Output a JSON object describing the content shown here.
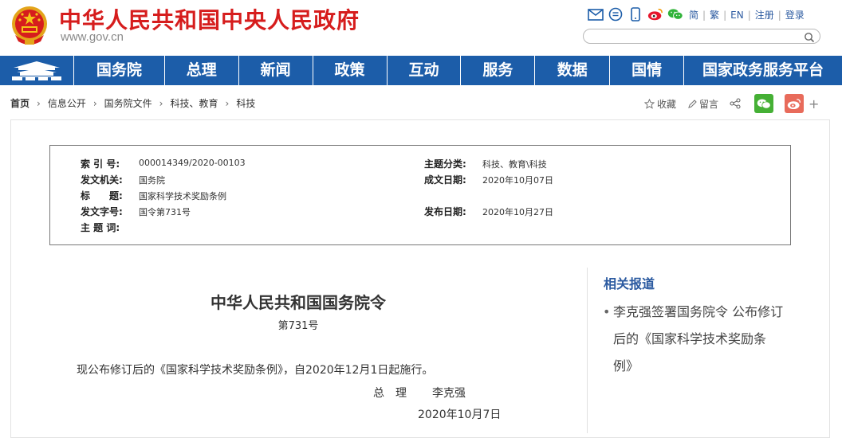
{
  "header": {
    "site_title": "中华人民共和国中央人民政府",
    "site_url": "www.gov.cn",
    "icons": [
      "mail-icon",
      "message-icon",
      "mobile-icon",
      "weibo-icon",
      "wechat-icon"
    ],
    "links": [
      "简",
      "繁",
      "EN",
      "注册",
      "登录"
    ],
    "search_placeholder": "",
    "brand_color": "#d61d1d"
  },
  "nav": {
    "bg_color": "#1c5da9",
    "items": [
      "国务院",
      "总理",
      "新闻",
      "政策",
      "互动",
      "服务",
      "数据",
      "国情",
      "国家政务服务平台"
    ]
  },
  "breadcrumb": [
    "首页",
    "信息公开",
    "国务院文件",
    "科技、教育",
    "科技"
  ],
  "share": {
    "favorite_label": "收藏",
    "comment_label": "留言",
    "more_label": "+"
  },
  "meta": {
    "index_no_label": "索 引 号:",
    "index_no": "000014349/2020-00103",
    "topic_label": "主题分类:",
    "topic": "科技、教育\\科技",
    "issuer_label": "发文机关:",
    "issuer": "国务院",
    "created_label": "成文日期:",
    "created": "2020年10月07日",
    "title_label": "标　　题:",
    "title": "国家科学技术奖励条例",
    "doc_no_label": "发文字号:",
    "doc_no": "国令第731号",
    "published_label": "发布日期:",
    "published": "2020年10月27日",
    "keywords_label": "主 题 词:",
    "keywords": ""
  },
  "document": {
    "title": "中华人民共和国国务院令",
    "number": "第731号",
    "body": "现公布修订后的《国家科学技术奖励条例》，自2020年12月1日起施行。",
    "sign_role": "总　理",
    "sign_name": "李克强",
    "date": "2020年10月7日"
  },
  "related": {
    "title": "相关报道",
    "items": [
      {
        "lines": [
          "李克强签署国务院令 公布修订",
          "后的《国家科学技术奖励条",
          "例》"
        ]
      }
    ]
  }
}
